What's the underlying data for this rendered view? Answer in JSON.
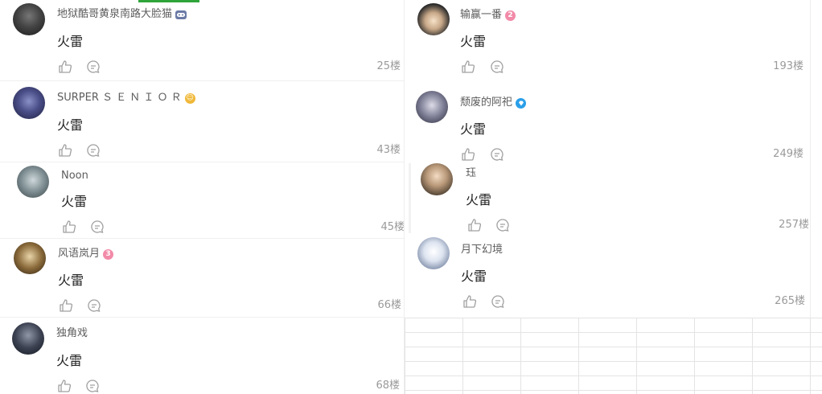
{
  "floor_suffix": "楼",
  "comments": [
    {
      "username": "地狱酷哥黄泉南路大脸猫",
      "badge": "game-controller",
      "badge_color": "#6b7aa6",
      "text": "火雷",
      "floor": "25楼"
    },
    {
      "username": "SURPER Ｓ Ｅ Ｎ Ｉ Ｏ Ｒ",
      "badge": "emoji",
      "badge_color": "#e0a020",
      "text": "火雷",
      "floor": "43楼"
    },
    {
      "username": "Noon",
      "badge": "",
      "text": "火雷",
      "floor": "45楼"
    },
    {
      "username": "风语岚月",
      "badge": "level-3",
      "badge_color": "#f28aa8",
      "badge_text": "3",
      "text": "火雷",
      "floor": "66楼"
    },
    {
      "username": "独角戏",
      "badge": "",
      "text": "火雷",
      "floor": "68楼"
    },
    {
      "username": "输赢一番",
      "badge": "level-2",
      "badge_color": "#f28aa8",
      "badge_text": "2",
      "text": "火雷",
      "floor": "193楼"
    },
    {
      "username": "颓废的阿祀",
      "badge": "verified-diamond",
      "badge_color": "#2a9fe8",
      "text": "火雷",
      "floor": "249楼"
    },
    {
      "username": "珏",
      "badge": "",
      "text": "火雷",
      "floor": "257楼"
    },
    {
      "username": "月下幻境",
      "badge": "",
      "text": "火雷",
      "floor": "265楼"
    }
  ],
  "colors": {
    "accent_green": "#2ea43a",
    "grid_line": "#e4e4e4",
    "text_gray": "#9a9a9a"
  }
}
